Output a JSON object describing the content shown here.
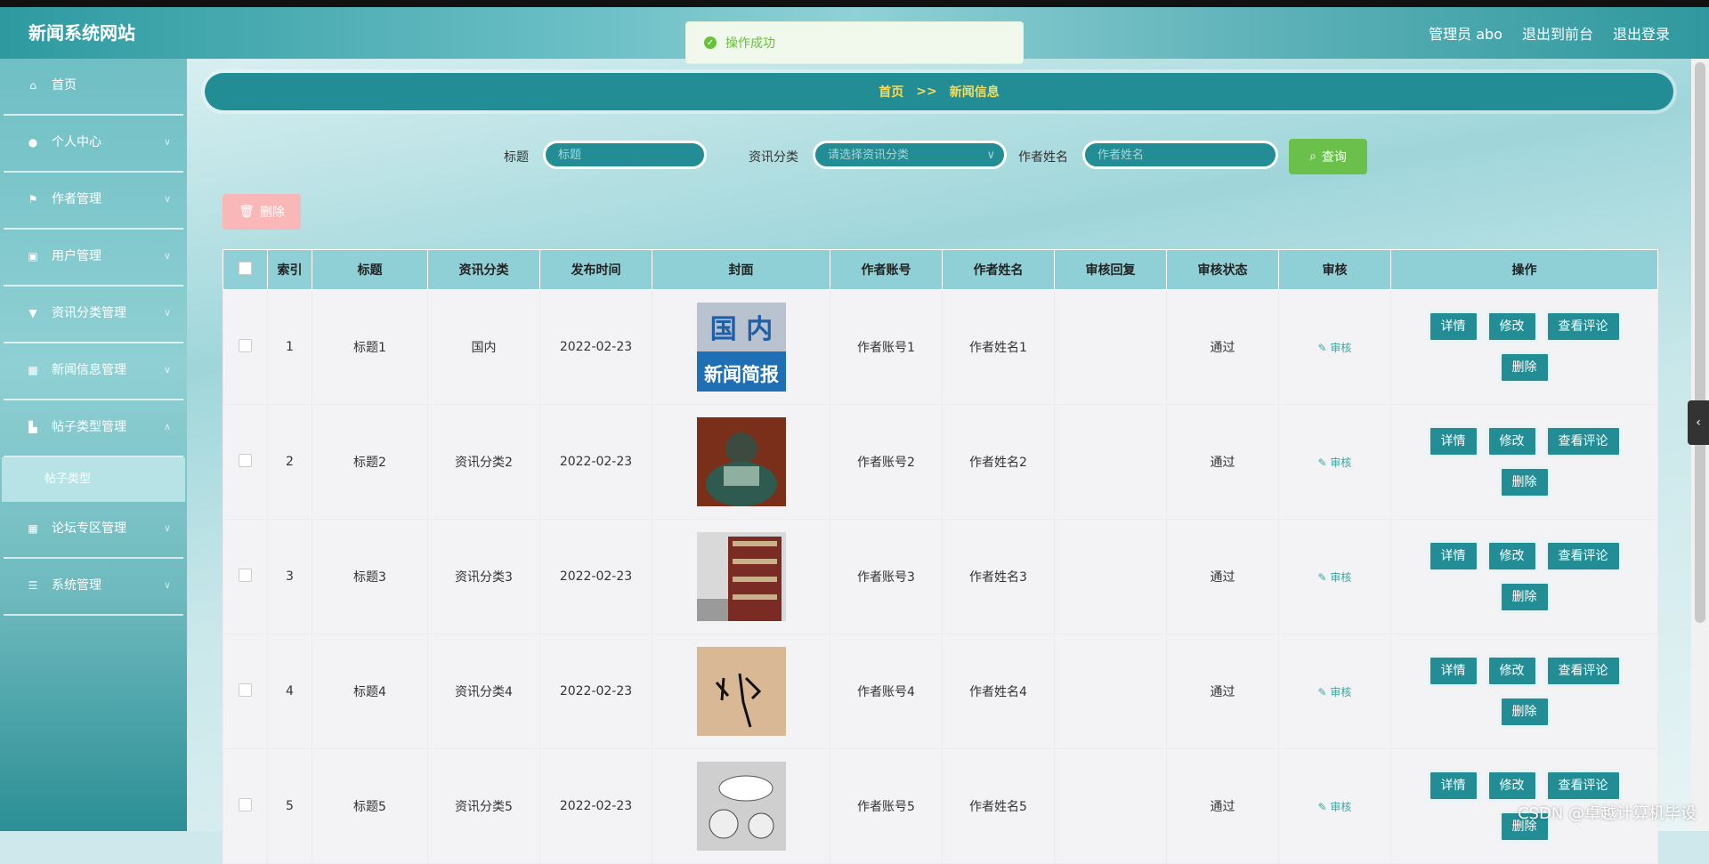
{
  "header": {
    "brand": "新闻系统网站",
    "user": "管理员 abo",
    "to_front": "退出到前台",
    "logout": "退出登录"
  },
  "toast": {
    "message": "操作成功"
  },
  "sidebar": {
    "items": [
      {
        "label": "首页",
        "icon": "home-icon"
      },
      {
        "label": "个人中心",
        "icon": "user-icon"
      },
      {
        "label": "作者管理",
        "icon": "flag-icon"
      },
      {
        "label": "用户管理",
        "icon": "clipboard-icon"
      },
      {
        "label": "资讯分类管理",
        "icon": "marker-icon"
      },
      {
        "label": "新闻信息管理",
        "icon": "grid-icon"
      },
      {
        "label": "帖子类型管理",
        "icon": "chart-icon"
      }
    ],
    "sub_item": "帖子类型",
    "items_after": [
      {
        "label": "论坛专区管理",
        "icon": "grid-icon"
      },
      {
        "label": "系统管理",
        "icon": "sliders-icon"
      }
    ]
  },
  "breadcrumb": {
    "home": "首页",
    "sep": ">>",
    "current": "新闻信息"
  },
  "search": {
    "title_label": "标题",
    "title_placeholder": "标题",
    "category_label": "资讯分类",
    "category_placeholder": "请选择资讯分类",
    "author_label": "作者姓名",
    "author_placeholder": "作者姓名",
    "query_button": "查询"
  },
  "delete_button": "删除",
  "table": {
    "columns": [
      "索引",
      "标题",
      "资讯分类",
      "发布时间",
      "封面",
      "作者账号",
      "作者姓名",
      "审核回复",
      "审核状态",
      "审核",
      "操作"
    ],
    "audit_label": "审核",
    "actions": [
      "详情",
      "修改",
      "查看评论",
      "删除"
    ],
    "rows": [
      {
        "index": "1",
        "title": "标题1",
        "category": "国内",
        "date": "2022-02-23",
        "account": "作者账号1",
        "name": "作者姓名1",
        "reply": "",
        "status": "通过",
        "cover_text": [
          "国 内",
          "新闻简报"
        ]
      },
      {
        "index": "2",
        "title": "标题2",
        "category": "资讯分类2",
        "date": "2022-02-23",
        "account": "作者账号2",
        "name": "作者姓名2",
        "reply": "",
        "status": "通过"
      },
      {
        "index": "3",
        "title": "标题3",
        "category": "资讯分类3",
        "date": "2022-02-23",
        "account": "作者账号3",
        "name": "作者姓名3",
        "reply": "",
        "status": "通过"
      },
      {
        "index": "4",
        "title": "标题4",
        "category": "资讯分类4",
        "date": "2022-02-23",
        "account": "作者账号4",
        "name": "作者姓名4",
        "reply": "",
        "status": "通过"
      },
      {
        "index": "5",
        "title": "标题5",
        "category": "资讯分类5",
        "date": "2022-02-23",
        "account": "作者账号5",
        "name": "作者姓名5",
        "reply": "",
        "status": "通过"
      }
    ]
  },
  "watermark": "CSDN @卓越计算机毕设"
}
